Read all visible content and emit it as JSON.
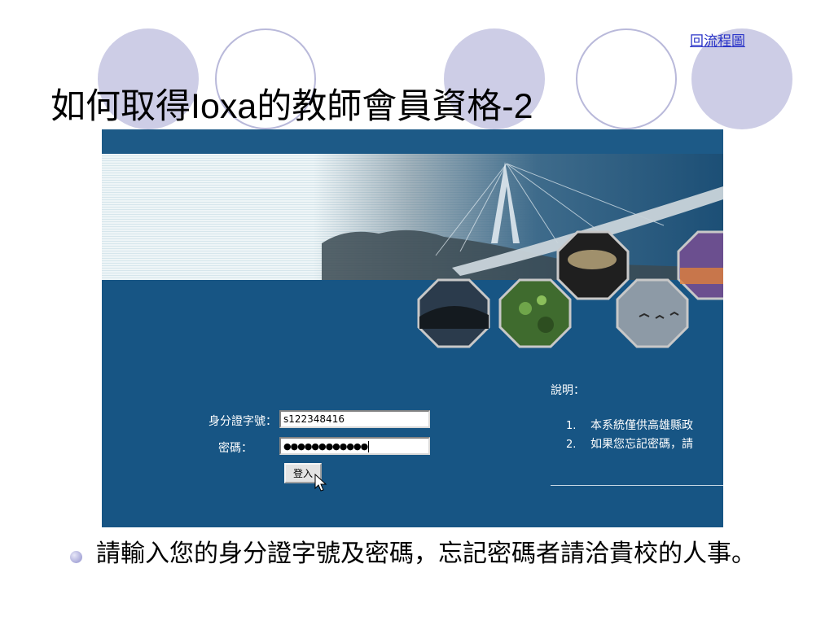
{
  "nav": {
    "back_label": "回流程圖"
  },
  "slide": {
    "title": "如何取得Ioxa的教師會員資格-2"
  },
  "login_form": {
    "id_label": "身分證字號：",
    "id_value": "s122348416",
    "password_label": "密碼：",
    "password_value": "●●●●●●●●●●●●",
    "submit_label": "登入"
  },
  "info_panel": {
    "heading": "說明：",
    "items": [
      {
        "num": "1.",
        "text": "本系統僅供高雄縣政"
      },
      {
        "num": "2.",
        "text": "如果您忘記密碼，請"
      }
    ]
  },
  "bullet": {
    "text": "請輸入您的身分證字號及密碼，忘記密碼者請洽貴校的人事。"
  },
  "colors": {
    "screen_background": "#175584",
    "accent_circle": "#cdcde6",
    "link": "#2a34c8"
  }
}
